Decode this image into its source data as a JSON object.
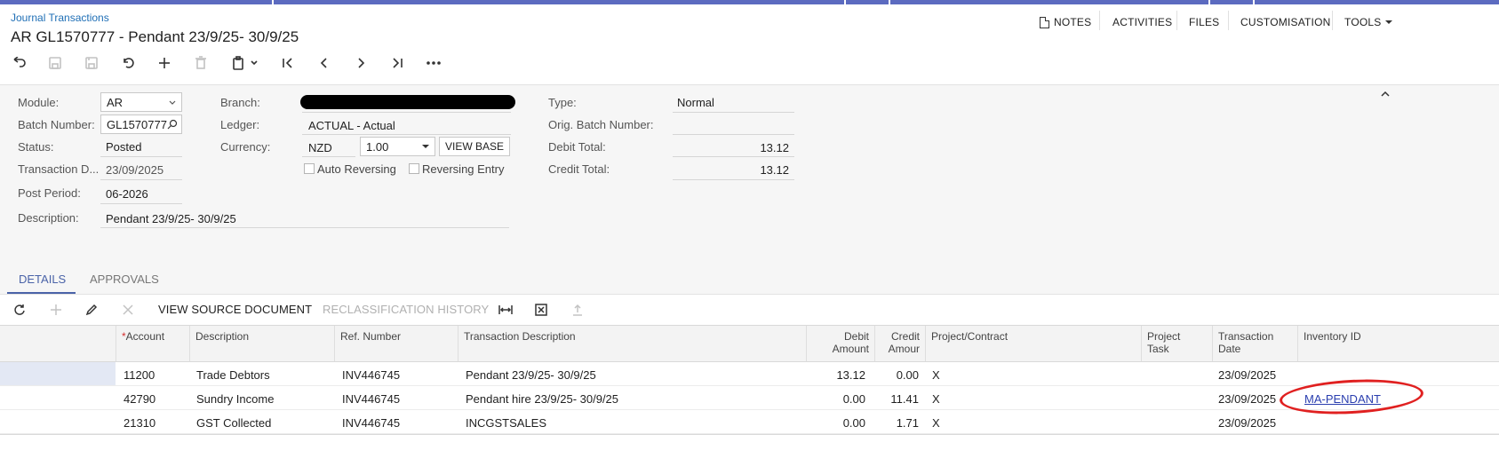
{
  "header": {
    "breadcrumb": "Journal Transactions",
    "title": "AR GL1570777 - Pendant 23/9/25- 30/9/25",
    "menu": {
      "notes": "NOTES",
      "activities": "ACTIVITIES",
      "files": "FILES",
      "customisation": "CUSTOMISATION",
      "tools": "TOOLS"
    }
  },
  "toolbar_icons": [
    "back-icon",
    "save-close-icon",
    "save-icon",
    "undo-icon",
    "add-icon",
    "delete-icon",
    "copy-paste-icon",
    "first-icon",
    "previous-icon",
    "next-icon",
    "last-icon",
    "more-icon"
  ],
  "form": {
    "module_label": "Module:",
    "module_value": "AR",
    "batch_label": "Batch Number:",
    "batch_value": "GL1570777",
    "status_label": "Status:",
    "status_value": "Posted",
    "trans_date_label": "Transaction D...",
    "trans_date_value": "23/09/2025",
    "post_period_label": "Post Period:",
    "post_period_value": "06-2026",
    "description_label": "Description:",
    "description_value": "Pendant 23/9/25- 30/9/25",
    "branch_label": "Branch:",
    "ledger_label": "Ledger:",
    "ledger_value": "ACTUAL - Actual",
    "currency_label": "Currency:",
    "currency_value": "NZD",
    "rate_value": "1.00",
    "view_base_label": "VIEW BASE",
    "auto_reversing_label": "Auto Reversing",
    "reversing_entry_label": "Reversing Entry",
    "type_label": "Type:",
    "type_value": "Normal",
    "orig_batch_label": "Orig. Batch Number:",
    "debit_total_label": "Debit Total:",
    "debit_total_value": "13.12",
    "credit_total_label": "Credit Total:",
    "credit_total_value": "13.12"
  },
  "tabs": {
    "details": "DETAILS",
    "approvals": "APPROVALS"
  },
  "grid_toolbar": {
    "view_source": "VIEW SOURCE DOCUMENT",
    "reclass_history": "RECLASSIFICATION HISTORY"
  },
  "grid": {
    "columns": {
      "account": "Account",
      "description": "Description",
      "ref_number": "Ref. Number",
      "transaction_description": "Transaction Description",
      "debit_amount_1": "Debit",
      "debit_amount_2": "Amount",
      "credit_amount_1": "Credit",
      "credit_amount_2": "Amour",
      "project_contract": "Project/Contract",
      "project_task_1": "Project",
      "project_task_2": "Task",
      "transaction_date_1": "Transaction",
      "transaction_date_2": "Date",
      "inventory_id": "Inventory ID"
    },
    "rows": [
      {
        "account": "11200",
        "description": "Trade Debtors",
        "ref": "INV446745",
        "trans_desc": "Pendant 23/9/25- 30/9/25",
        "debit": "13.12",
        "credit": "0.00",
        "project": "X",
        "date": "23/09/2025",
        "inventory": ""
      },
      {
        "account": "42790",
        "description": "Sundry Income",
        "ref": "INV446745",
        "trans_desc": "Pendant hire 23/9/25- 30/9/25",
        "debit": "0.00",
        "credit": "11.41",
        "project": "X",
        "date": "23/09/2025",
        "inventory": "MA-PENDANT"
      },
      {
        "account": "21310",
        "description": "GST Collected",
        "ref": "INV446745",
        "trans_desc": "INCGSTSALES",
        "debit": "0.00",
        "credit": "1.71",
        "project": "X",
        "date": "23/09/2025",
        "inventory": ""
      }
    ]
  },
  "colors": {
    "accent": "#5c6bc0",
    "link": "#1f6fb6",
    "annotation": "#e02020"
  }
}
